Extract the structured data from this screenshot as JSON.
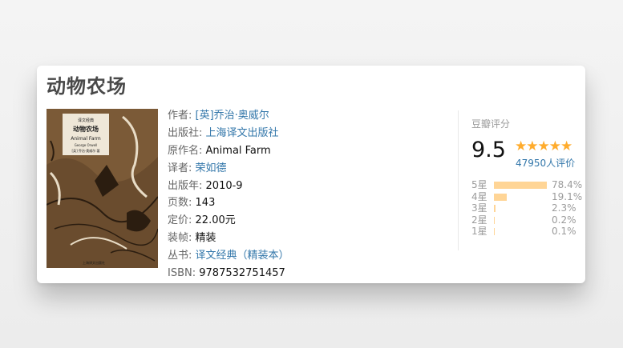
{
  "book": {
    "title": "动物农场",
    "cover": {
      "series_label": "译文经典",
      "title_cn": "动物农场",
      "title_en": "Animal Farm",
      "author_en": "George Orwell",
      "author_cn": "[英] 乔治·奥威尔 著",
      "publisher": "上海译文出版社"
    },
    "info": [
      {
        "label": "作者:",
        "value": "[英]乔治·奥威尔",
        "link": true
      },
      {
        "label": "出版社:",
        "value": "上海译文出版社",
        "link": true
      },
      {
        "label": "原作名:",
        "value": "Animal Farm",
        "link": false
      },
      {
        "label": "译者:",
        "value": "荣如德",
        "link": true
      },
      {
        "label": "出版年:",
        "value": "2010-9",
        "link": false
      },
      {
        "label": "页数:",
        "value": "143",
        "link": false
      },
      {
        "label": "定价:",
        "value": "22.00元",
        "link": false
      },
      {
        "label": "装帧:",
        "value": "精装",
        "link": false
      },
      {
        "label": "丛书:",
        "value": "译文经典（精装本）",
        "link": true
      },
      {
        "label": "ISBN:",
        "value": "9787532751457",
        "link": false
      }
    ]
  },
  "rating": {
    "title": "豆瓣评分",
    "score": "9.5",
    "stars": "★★★★★",
    "star_count": 5,
    "people": "47950人评价",
    "distribution": [
      {
        "label": "5星",
        "percent": "78.4%",
        "value": 78.4
      },
      {
        "label": "4星",
        "percent": "19.1%",
        "value": 19.1
      },
      {
        "label": "3星",
        "percent": "2.3%",
        "value": 2.3
      },
      {
        "label": "2星",
        "percent": "0.2%",
        "value": 0.2
      },
      {
        "label": "1星",
        "percent": "0.1%",
        "value": 0.1
      }
    ]
  },
  "colors": {
    "link": "#3377aa",
    "star": "#ffac2d",
    "bar": "#ffd596",
    "label": "#666666"
  }
}
